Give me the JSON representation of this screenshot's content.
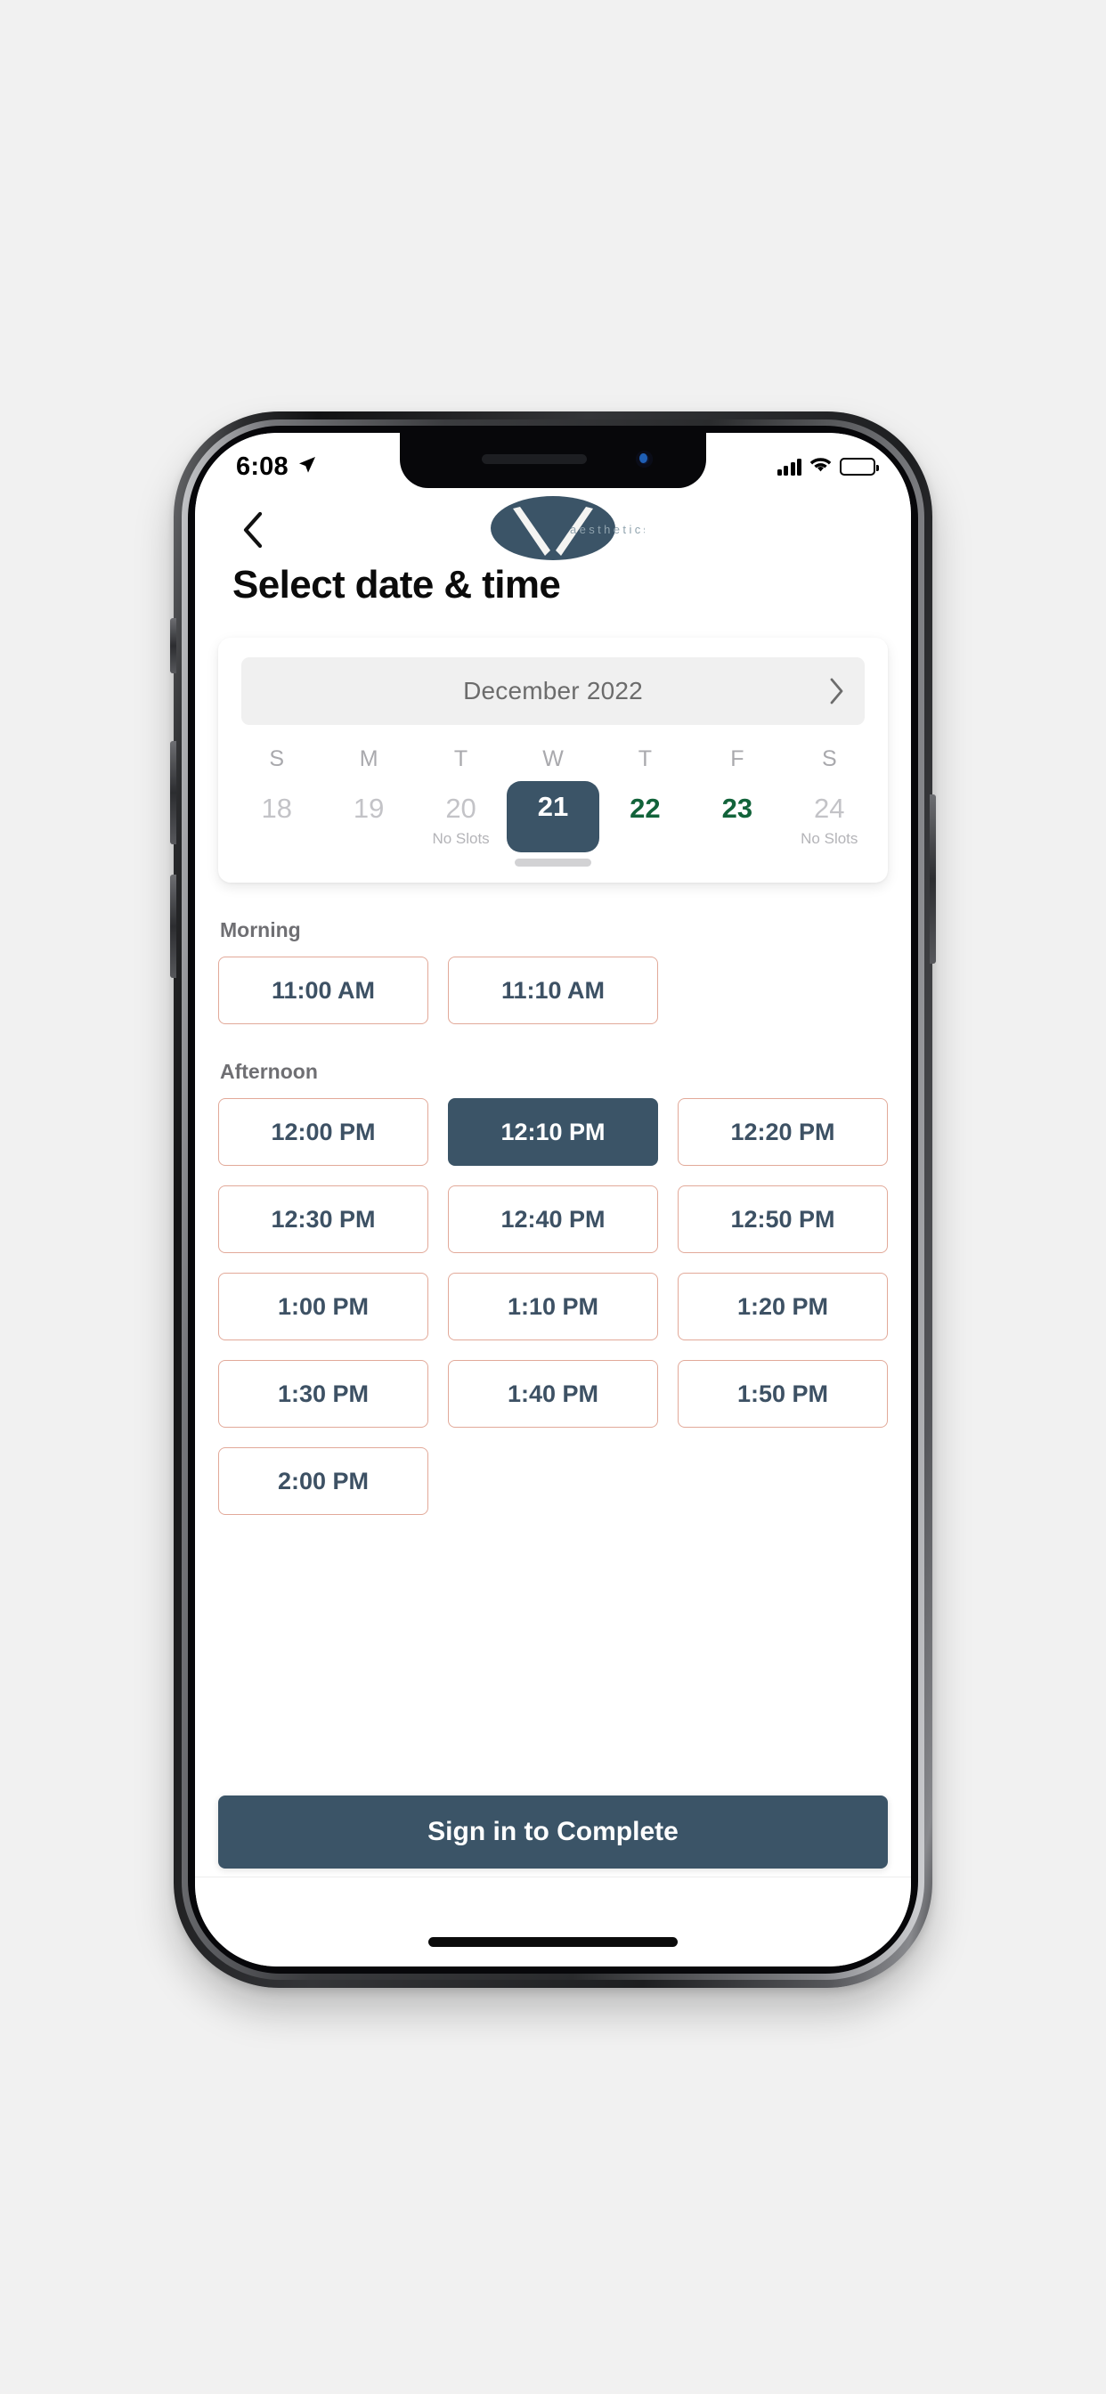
{
  "status_bar": {
    "time": "6:08",
    "location_icon": "location-arrow-icon",
    "signal_icon": "cellular-signal-icon",
    "wifi_icon": "wifi-icon",
    "battery_icon": "battery-icon",
    "battery_color": "#fcc52b"
  },
  "nav": {
    "back_icon": "chevron-left-icon",
    "logo_name": "v-aesthetics-logo",
    "logo_text": "aesthetics",
    "logo_color": "#3b5467"
  },
  "page": {
    "title": "Select date & time"
  },
  "calendar": {
    "month_label": "December 2022",
    "next_icon": "chevron-right-icon",
    "weekdays": [
      "S",
      "M",
      "T",
      "W",
      "T",
      "F",
      "S"
    ],
    "days": [
      {
        "num": "18",
        "note": "",
        "state": "muted"
      },
      {
        "num": "19",
        "note": "",
        "state": "muted"
      },
      {
        "num": "20",
        "note": "No Slots",
        "state": "muted"
      },
      {
        "num": "21",
        "note": "",
        "state": "selected"
      },
      {
        "num": "22",
        "note": "",
        "state": "avail"
      },
      {
        "num": "23",
        "note": "",
        "state": "avail"
      },
      {
        "num": "24",
        "note": "No Slots",
        "state": "muted"
      }
    ],
    "selected_color": "#3b5467",
    "available_color": "#12633a"
  },
  "slots": {
    "groups": [
      {
        "label": "Morning",
        "times": [
          {
            "label": "11:00 AM",
            "selected": false
          },
          {
            "label": "11:10 AM",
            "selected": false
          }
        ]
      },
      {
        "label": "Afternoon",
        "times": [
          {
            "label": "12:00 PM",
            "selected": false
          },
          {
            "label": "12:10 PM",
            "selected": true
          },
          {
            "label": "12:20 PM",
            "selected": false
          },
          {
            "label": "12:30 PM",
            "selected": false
          },
          {
            "label": "12:40 PM",
            "selected": false
          },
          {
            "label": "12:50 PM",
            "selected": false
          },
          {
            "label": "1:00 PM",
            "selected": false
          },
          {
            "label": "1:10 PM",
            "selected": false
          },
          {
            "label": "1:20 PM",
            "selected": false
          },
          {
            "label": "1:30 PM",
            "selected": false
          },
          {
            "label": "1:40 PM",
            "selected": false
          },
          {
            "label": "1:50 PM",
            "selected": false
          },
          {
            "label": "2:00 PM",
            "selected": false
          }
        ]
      }
    ],
    "border_color": "#e2a999",
    "text_color": "#3d5164"
  },
  "cta": {
    "label": "Sign in to Complete",
    "color": "#3b5467"
  }
}
